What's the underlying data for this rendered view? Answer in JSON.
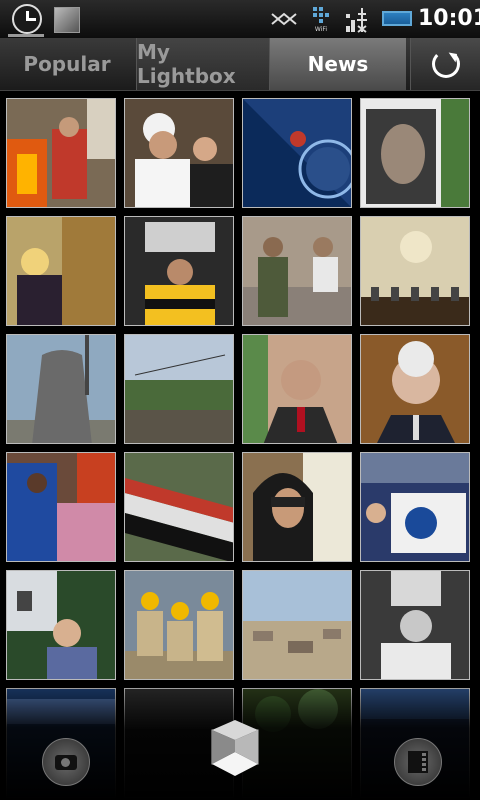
{
  "status_bar": {
    "time": "10:01",
    "icons": [
      "clock-icon",
      "cube-small-icon",
      "wifi-share-icon",
      "wifi-icon",
      "signal-icon",
      "battery-icon"
    ],
    "wifi_label": "WiFi"
  },
  "tabs": [
    {
      "label": "Popular",
      "active": false
    },
    {
      "label": "My Lightbox",
      "active": false
    },
    {
      "label": "News",
      "active": true
    }
  ],
  "actions": {
    "refresh": "refresh-icon",
    "camera": "camera-icon",
    "film": "film-icon",
    "home": "cube-icon"
  },
  "colors": {
    "background": "#000000",
    "active_tab": "#6a6a6a",
    "battery": "#2d7fc0"
  },
  "thumbnails": [
    {
      "subject": "protest-fire"
    },
    {
      "subject": "cleric-portrait"
    },
    {
      "subject": "planet-art"
    },
    {
      "subject": "magazine-model"
    },
    {
      "subject": "woman-statue"
    },
    {
      "subject": "hockey-cup"
    },
    {
      "subject": "man-rocks"
    },
    {
      "subject": "hearing-room"
    },
    {
      "subject": "cooling-tower"
    },
    {
      "subject": "field-landscape"
    },
    {
      "subject": "politician-portrait"
    },
    {
      "subject": "official-portrait"
    },
    {
      "subject": "crowd-women"
    },
    {
      "subject": "flag-parade"
    },
    {
      "subject": "woman-sunglasses"
    },
    {
      "subject": "hockey-fans"
    },
    {
      "subject": "man-by-house"
    },
    {
      "subject": "hardhat-workers"
    },
    {
      "subject": "aerial-town"
    },
    {
      "subject": "cup-celebration"
    },
    {
      "subject": "stage-event"
    },
    {
      "subject": "dark-scene"
    },
    {
      "subject": "trees-scene"
    },
    {
      "subject": "blue-scene"
    }
  ]
}
